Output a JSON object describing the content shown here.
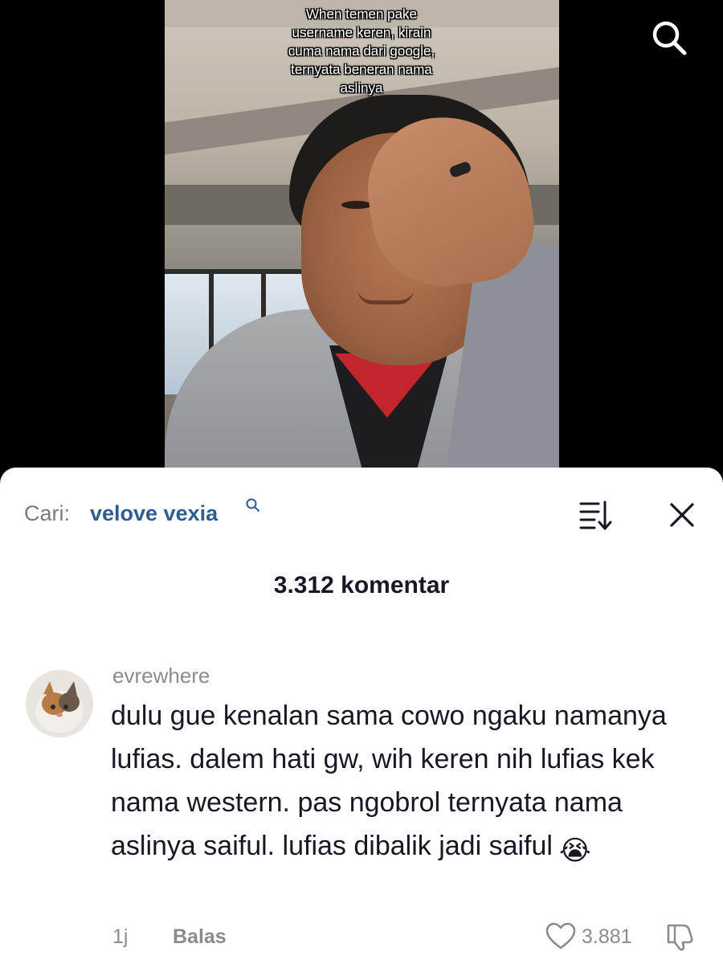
{
  "video": {
    "caption_lines": [
      "When temen pake",
      "username keren, kirain",
      "cuma nama dari google,",
      "ternyata beneran nama",
      "aslinya"
    ],
    "search_icon": "search-icon"
  },
  "search": {
    "prefix": "Cari:",
    "term": "velove vexia",
    "term_icon": "search-icon",
    "sort_icon": "sort-icon",
    "close_icon": "close-icon"
  },
  "comments_count": "3.312 komentar",
  "comment": {
    "username": "evrewhere",
    "text": "dulu gue kenalan sama cowo ngaku namanya lufias. dalem hati gw, wih keren nih lufias kek nama western. pas ngobrol ternyata nama aslinya saiful. lufias dibalik jadi saiful",
    "emoji": "😭",
    "time": "1j",
    "reply_label": "Balas",
    "like_count": "3.881",
    "like_icon": "heart-icon",
    "dislike_icon": "dislike-icon"
  },
  "colors": {
    "search_term": "#2f5d93",
    "muted": "#8a8b91",
    "text": "#161823"
  }
}
